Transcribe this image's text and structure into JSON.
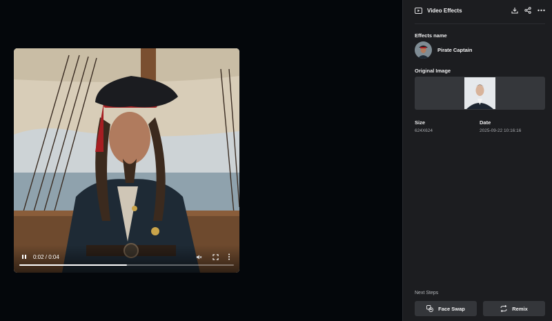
{
  "player": {
    "time_display": "0:02 / 0:04",
    "progress_fraction": 0.5
  },
  "panel": {
    "title": "Video Effects",
    "effects_name_label": "Effects name",
    "effect_name": "Pirate Captain",
    "original_image_label": "Original Image",
    "size_label": "Size",
    "size_value": "624X624",
    "date_label": "Date",
    "date_value": "2025-09-22 10:16:16",
    "next_steps_label": "Next Steps",
    "buttons": {
      "face_swap": "Face Swap",
      "remix": "Remix"
    },
    "icons": [
      "video-effects-icon",
      "download-icon",
      "share-icon",
      "more-icon",
      "face-swap-icon",
      "remix-icon"
    ]
  }
}
